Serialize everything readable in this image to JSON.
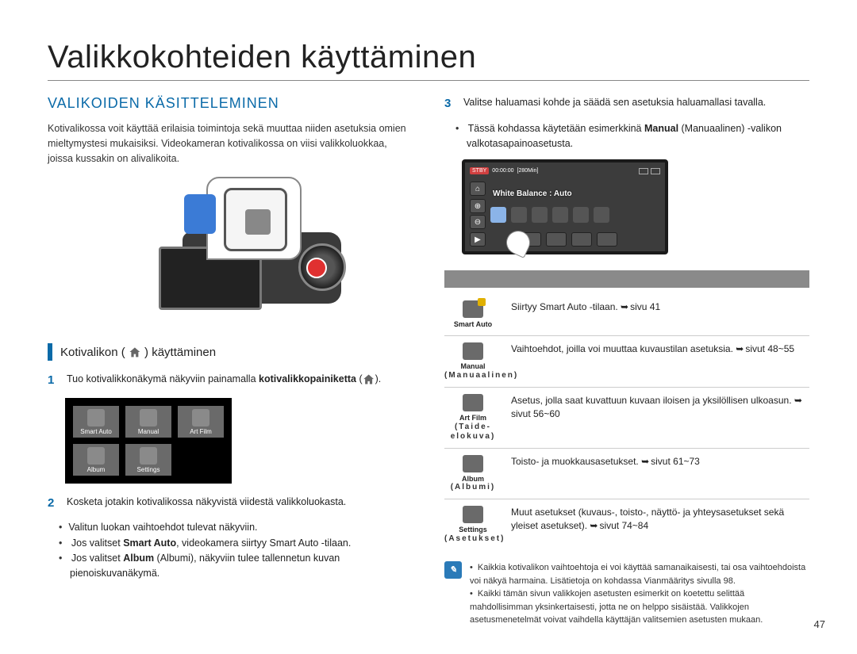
{
  "page": {
    "title": "Valikkokohteiden käyttäminen",
    "number": "47"
  },
  "left": {
    "heading": "VALIKOIDEN KÄSITTELEMINEN",
    "intro": "Kotivalikossa voit käyttää erilaisia toimintoja sekä muuttaa niiden asetuksia omien mieltymystesi mukaisiksi. Videokameran kotivalikossa on viisi valikkoluokkaa, joissa kussakin on alivalikoita.",
    "subhead_prefix": "Kotivalikon (",
    "subhead_suffix": ") käyttäminen",
    "step1_pre": "Tuo kotivalikkonäkymä näkyviin painamalla ",
    "step1_bold": "kotivalikkopainiketta",
    "step1_post": " (",
    "step1_end": ").",
    "grid": [
      "Smart Auto",
      "Manual",
      "Art Film",
      "Album",
      "Settings"
    ],
    "step2": "Kosketa jotakin kotivalikossa näkyvistä viidestä valikkoluokasta.",
    "step2_b1": "Valitun luokan vaihtoehdot tulevat näkyviin.",
    "step2_b2_pre": "Jos valitset ",
    "step2_b2_bold": "Smart Auto",
    "step2_b2_post": ", videokamera siirtyy Smart Auto -tilaan.",
    "step2_b3_pre": "Jos valitset ",
    "step2_b3_bold": "Album",
    "step2_b3_post": " (Albumi), näkyviin tulee tallennetun kuvan pienoiskuvanäkymä."
  },
  "right": {
    "step3": "Valitse haluamasi kohde ja säädä sen asetuksia haluamallasi tavalla.",
    "step3_b1_pre": "Tässä kohdassa käytetään esimerkkinä ",
    "step3_b1_bold": "Manual",
    "step3_b1_post": " (Manuaalinen) -valikon valkotasapainoasetusta.",
    "ss": {
      "stby": "STBY",
      "time": "00:00:00",
      "remain": "[280Min]",
      "wb": "White Balance : Auto"
    },
    "table": [
      {
        "icon": "Smart Auto",
        "sub": "",
        "desc_pre": "Siirtyy Smart Auto -tilaan. ",
        "desc_arrow": "sivu 41"
      },
      {
        "icon": "Manual",
        "sub": "(Manuaalinen)",
        "desc_pre": "Vaihtoehdot, joilla voi muuttaa kuvaustilan asetuksia. ",
        "desc_arrow": "sivut 48~55"
      },
      {
        "icon": "Art Film",
        "sub": "(Taide-elokuva)",
        "desc_pre": "Asetus, jolla saat kuvattuun kuvaan iloisen ja yksilöllisen ulkoasun. ",
        "desc_arrow": "sivut 56~60"
      },
      {
        "icon": "Album",
        "sub": "(Albumi)",
        "desc_pre": "Toisto- ja muokkausasetukset. ",
        "desc_arrow": "sivut 61~73"
      },
      {
        "icon": "Settings",
        "sub": "(Asetukset)",
        "desc_pre": "Muut asetukset (kuvaus-, toisto-, näyttö- ja yhteysasetukset sekä yleiset asetukset). ",
        "desc_arrow": "sivut 74~84"
      }
    ],
    "note1": "Kaikkia kotivalikon vaihtoehtoja ei voi käyttää samanaikaisesti, tai osa vaihtoehdoista voi näkyä harmaina. Lisätietoja on kohdassa Vianmääritys sivulla 98.",
    "note2": "Kaikki tämän sivun valikkojen asetusten esimerkit on koetettu selittää mahdollisimman yksinkertaisesti, jotta ne on helppo sisäistää. Valikkojen asetusmenetelmät voivat vaihdella käyttäjän valitsemien asetusten mukaan."
  }
}
